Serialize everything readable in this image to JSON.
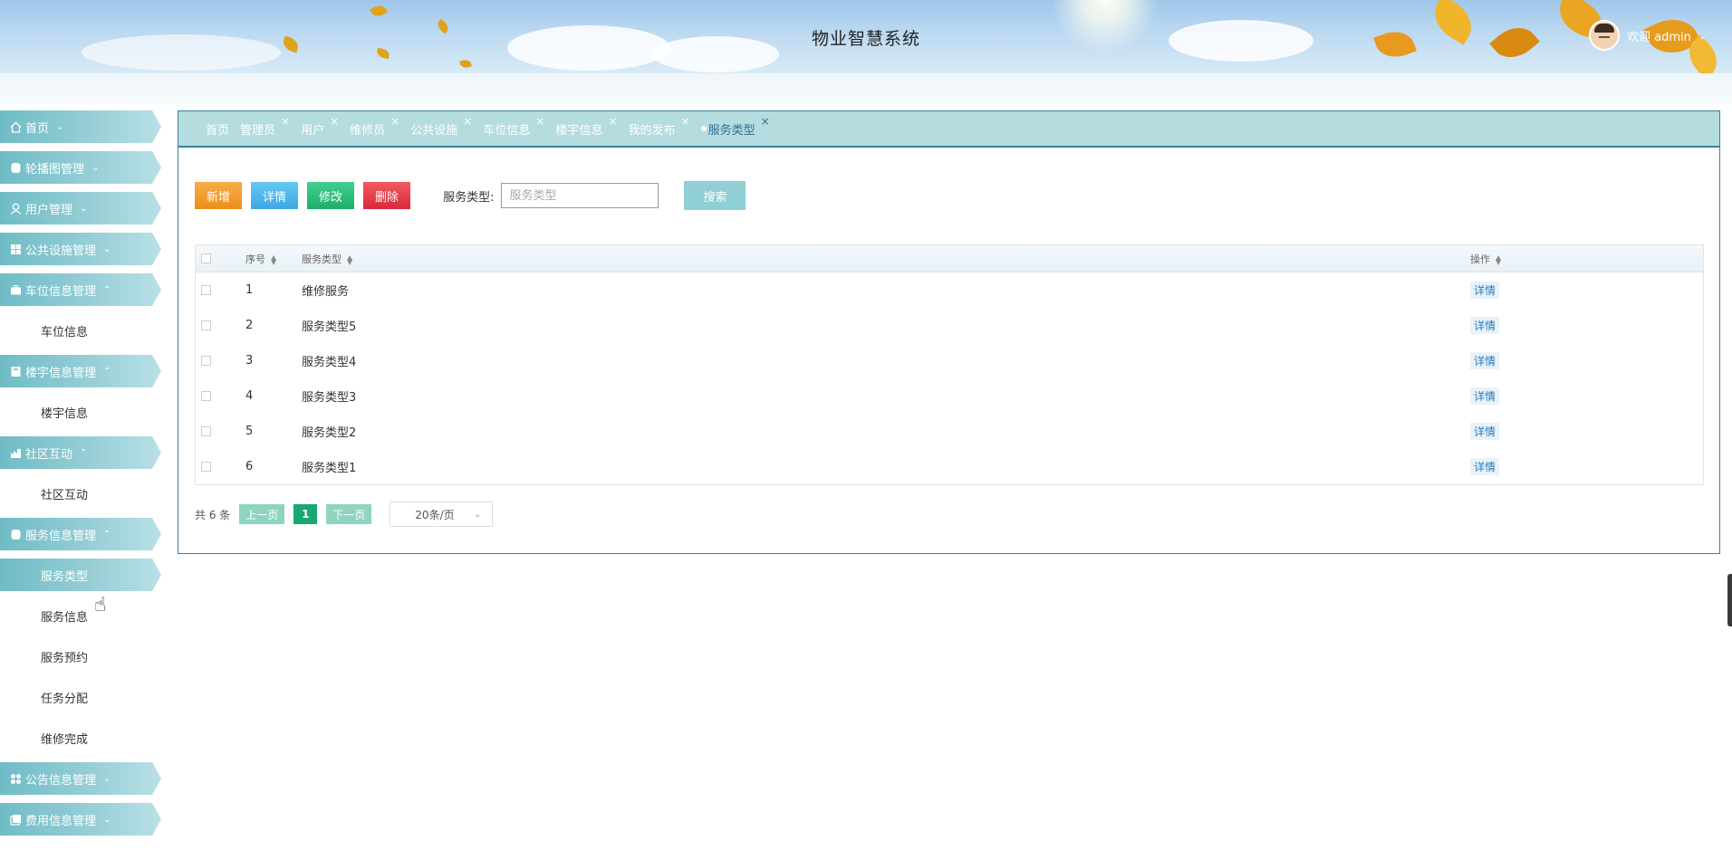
{
  "header": {
    "title": "物业智慧系统",
    "welcome": "欢迎 admin"
  },
  "sidebar": {
    "menus": [
      {
        "label": "首页",
        "icon": "home-icon",
        "expanded": false
      },
      {
        "label": "轮播图管理",
        "icon": "image-icon",
        "expanded": false
      },
      {
        "label": "用户管理",
        "icon": "user-icon",
        "expanded": false
      },
      {
        "label": "公共设施管理",
        "icon": "grid-icon",
        "expanded": false
      },
      {
        "label": "车位信息管理",
        "icon": "briefcase-icon",
        "expanded": true,
        "children": [
          "车位信息"
        ]
      },
      {
        "label": "楼宇信息管理",
        "icon": "book-icon",
        "expanded": true,
        "children": [
          "楼宇信息"
        ]
      },
      {
        "label": "社区互动",
        "icon": "chart-icon",
        "expanded": true,
        "children": [
          "社区互动"
        ]
      },
      {
        "label": "服务信息管理",
        "icon": "image-icon",
        "expanded": true,
        "children": [
          "服务类型",
          "服务信息",
          "服务预约",
          "任务分配",
          "维修完成"
        ],
        "active_child": "服务类型"
      },
      {
        "label": "公告信息管理",
        "icon": "apps-icon",
        "expanded": false
      },
      {
        "label": "费用信息管理",
        "icon": "copy-icon",
        "expanded": false
      }
    ]
  },
  "tabs": [
    {
      "label": "首页",
      "closable": false
    },
    {
      "label": "管理员",
      "closable": true
    },
    {
      "label": "用户",
      "closable": true
    },
    {
      "label": "维修员",
      "closable": true
    },
    {
      "label": "公共设施",
      "closable": true
    },
    {
      "label": "车位信息",
      "closable": true
    },
    {
      "label": "楼宇信息",
      "closable": true
    },
    {
      "label": "我的发布",
      "closable": true
    },
    {
      "label": "服务类型",
      "closable": true,
      "active": true
    }
  ],
  "toolbar": {
    "add_label": "新增",
    "detail_label": "详情",
    "edit_label": "修改",
    "delete_label": "删除",
    "search_label": "服务类型:",
    "search_placeholder": "服务类型",
    "search_button": "搜索"
  },
  "table": {
    "headers": {
      "index": "序号",
      "name": "服务类型",
      "op": "操作"
    },
    "rows": [
      {
        "index": "1",
        "name": "维修服务",
        "op": "详情"
      },
      {
        "index": "2",
        "name": "服务类型5",
        "op": "详情"
      },
      {
        "index": "3",
        "name": "服务类型4",
        "op": "详情"
      },
      {
        "index": "4",
        "name": "服务类型3",
        "op": "详情"
      },
      {
        "index": "5",
        "name": "服务类型2",
        "op": "详情"
      },
      {
        "index": "6",
        "name": "服务类型1",
        "op": "详情"
      }
    ]
  },
  "pager": {
    "total": "共 6 条",
    "prev": "上一页",
    "page": "1",
    "next": "下一页",
    "page_size": "20条/页"
  },
  "colors": {
    "sidebar_menu": "#8fcad3",
    "tab_bar": "#b5dcde",
    "border_accent": "#3b7fa1",
    "btn_add": "#ec8f1b",
    "btn_detail": "#3aa8e6",
    "btn_edit": "#1fae6a",
    "btn_delete": "#d8283a",
    "page_active": "#19a872"
  }
}
